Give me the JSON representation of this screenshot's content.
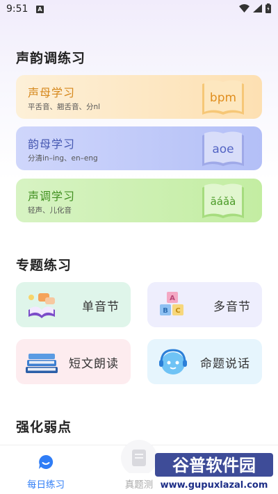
{
  "status_bar": {
    "time": "9:51",
    "notif_letter": "A"
  },
  "sections": {
    "tones": "声韵调练习",
    "topics": "专题练习",
    "weak": "强化弱点"
  },
  "cards": [
    {
      "title": "声母学习",
      "subtitle": "平舌音、翘舌音、分nl",
      "book_text": "bpm"
    },
    {
      "title": "韵母学习",
      "subtitle": "分清in–ing、en–eng",
      "book_text": "aoe"
    },
    {
      "title": "声调学习",
      "subtitle": "轻声、儿化音",
      "book_text": "āáǎà"
    }
  ],
  "tiles": [
    {
      "label": "单音节"
    },
    {
      "label": "多音节"
    },
    {
      "label": "短文朗读"
    },
    {
      "label": "命题说话"
    }
  ],
  "bottom_nav": {
    "daily": "每日练习",
    "test": "真题测"
  },
  "watermark": {
    "brand": "谷普软件园",
    "url": "www.gupuxlazal.com"
  },
  "colors": {
    "accent_blue": "#2f7df6"
  }
}
